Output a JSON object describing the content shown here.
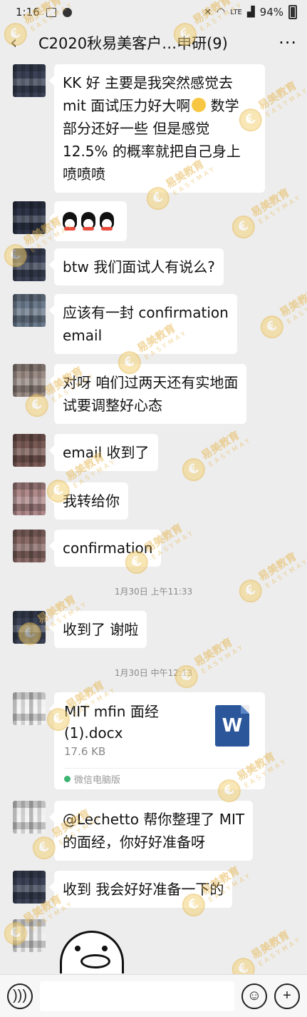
{
  "status_bar": {
    "time": "1:16",
    "signal": "LTE",
    "battery": "94%"
  },
  "nav": {
    "back_icon": "‹",
    "title": "C2020秋易美客户…申研(9)",
    "more_icon": "···"
  },
  "messages": [
    {
      "type": "text",
      "lines": [
        "KK 好 主要是我突然感觉去",
        "mit 面试压力好大啊",
        "部分还好一些 但是感觉",
        "12.5% 的概率就把自己身上",
        "喷喷喷"
      ],
      "emoji_after_line": 1,
      "line1_tail": "数学"
    },
    {
      "type": "emoji",
      "count": 3
    },
    {
      "type": "text",
      "lines": [
        "btw 我们面试人有说么?"
      ]
    },
    {
      "type": "text",
      "lines": [
        "应该有一封 confirmation",
        "email"
      ]
    },
    {
      "type": "text",
      "lines": [
        "对呀 咱们过两天还有实地面",
        "试要调整好心态"
      ]
    },
    {
      "type": "text",
      "lines": [
        "email 收到了"
      ]
    },
    {
      "type": "text",
      "lines": [
        "我转给你"
      ]
    },
    {
      "type": "text",
      "lines": [
        "confirmation"
      ]
    },
    {
      "type": "timestamp",
      "text": "1月30日 上午11:33"
    },
    {
      "type": "text",
      "lines": [
        "收到了 谢啦"
      ]
    },
    {
      "type": "timestamp",
      "text": "1月30日 中午12:13"
    },
    {
      "type": "file",
      "name": "MIT mfin 面经(1).docx",
      "size": "17.6 KB",
      "source": "微信电脑版",
      "icon_letter": "W"
    },
    {
      "type": "text",
      "lines": [
        "@Lechetto 帮你整理了 MIT",
        "的面经，你好好准备呀"
      ]
    },
    {
      "type": "text",
      "lines": [
        "收到 我会好好准备一下的"
      ]
    },
    {
      "type": "sticker"
    }
  ],
  "watermark": {
    "brand": "易美教育",
    "sub": "EASYMAY",
    "logo": "€"
  },
  "input_bar": {
    "voice_icon": "voice-icon",
    "emoji_icon": "emoji-icon",
    "plus_icon": "+"
  },
  "colors": {
    "background": "#ededed",
    "bubble": "#ffffff",
    "watermark": "#e6b64f",
    "word_icon": "#2b579a"
  }
}
